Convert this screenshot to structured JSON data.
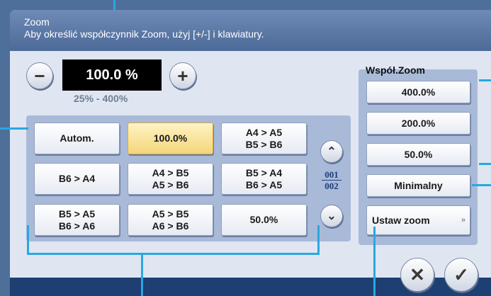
{
  "header": {
    "title": "Zoom",
    "instruction": "Aby określić współczynnik Zoom, użyj [+/-] i klawiatury."
  },
  "zoom": {
    "value": "100.0 %",
    "range": "25% - 400%",
    "minus_glyph": "−",
    "plus_glyph": "+"
  },
  "presets": [
    {
      "label": "Autom."
    },
    {
      "label": "100.0%",
      "selected": true
    },
    {
      "label": "A4 > A5\nB5 > B6"
    },
    {
      "label": "B6 > A4"
    },
    {
      "label": "A4 > B5\nA5 > B6"
    },
    {
      "label": "B5 > A4\nB6 > A5"
    },
    {
      "label": "B5 > A5\nB6 > A6"
    },
    {
      "label": "A5 > B5\nA6 > B6"
    },
    {
      "label": "50.0%"
    }
  ],
  "paging": {
    "current": "001",
    "total": "002",
    "up_glyph": "⌃",
    "down_glyph": "⌄"
  },
  "ratio_panel": {
    "title": "Współ.Zoom",
    "buttons": [
      "400.0%",
      "200.0%",
      "50.0%",
      "Minimalny"
    ],
    "set_zoom": "Ustaw zoom",
    "set_zoom_glyph": "»"
  },
  "actions": {
    "cancel_glyph": "✕",
    "ok_glyph": "✓"
  },
  "colors": {
    "selected_fill": "#f4d57a",
    "header": "#5a77a6",
    "callout": "#2aa7e0"
  }
}
